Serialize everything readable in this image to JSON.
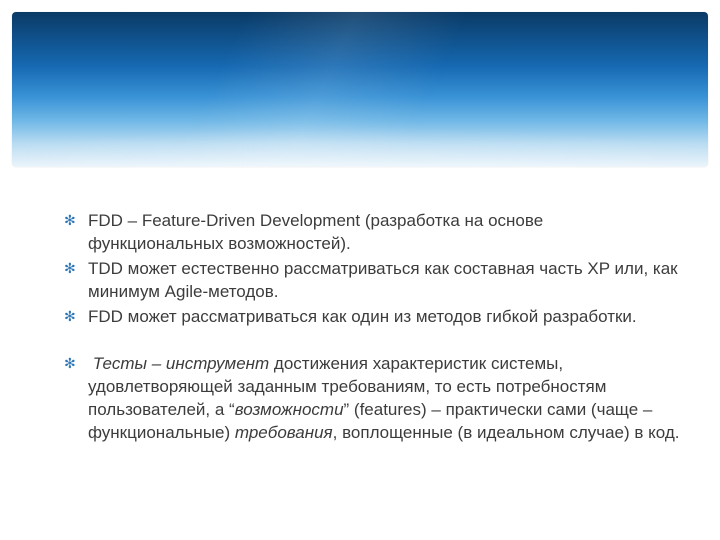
{
  "bullets": [
    {
      "text": "FDD – Feature-Driven Development (разработка на основе функциональных возможностей)."
    },
    {
      "text": "TDD может естественно рассматриваться как составная часть XP или, как минимум Agile-методов."
    },
    {
      "text": "FDD может рассматриваться как один из методов гибкой разработки."
    }
  ],
  "bullet_tests": {
    "part1_italic": "Тесты – инструмент",
    "part2": " достижения характеристик системы, удовлетворяющей заданным требованиям, то есть потребностям пользователей, а “",
    "part3_italic": "возможности",
    "part4": "” (features) – практически сами (чаще – функциональные) ",
    "part5_italic": "требования",
    "part6": ", воплощенные (в идеальном случае) в код."
  }
}
